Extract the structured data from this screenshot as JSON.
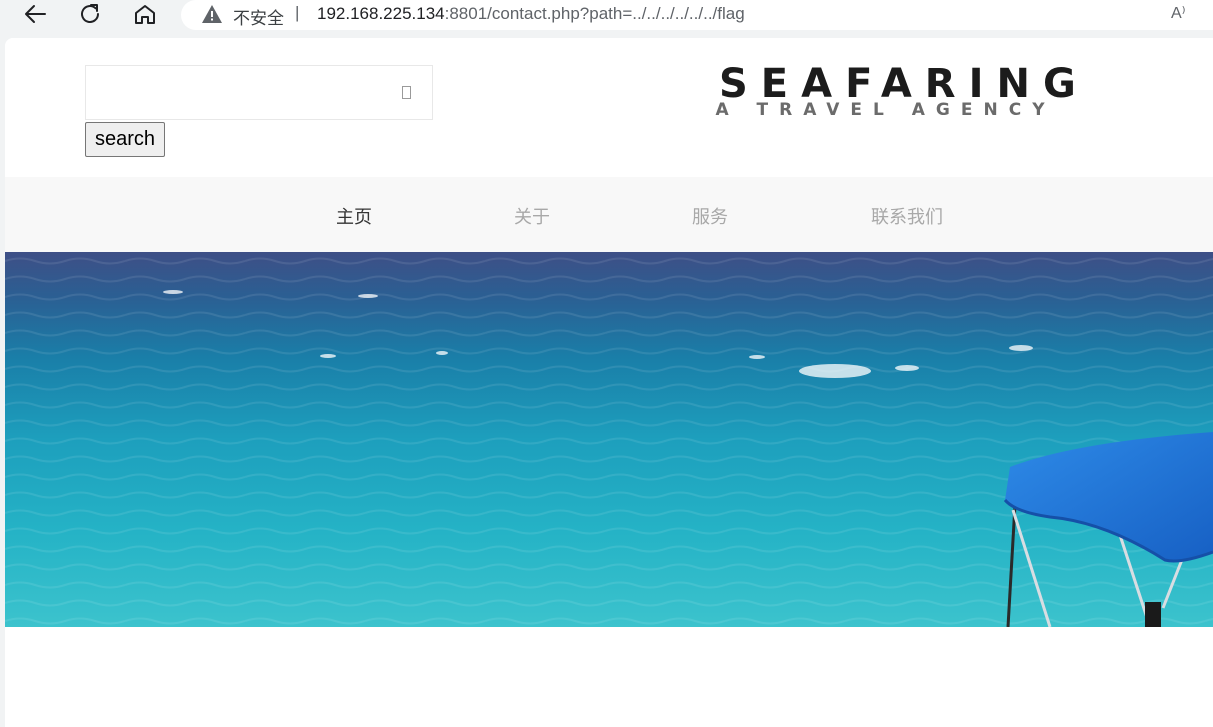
{
  "browser": {
    "security_label": "不安全",
    "separator": "|",
    "url_host": "192.168.225.134",
    "url_rest": ":8801/contact.php?path=../../../../../../flag",
    "icons": [
      "back-arrow-icon",
      "refresh-icon",
      "home-icon",
      "warning-icon",
      "read-aloud-icon"
    ],
    "read_aloud_glyph": "A⁾"
  },
  "header": {
    "search": {
      "value": "",
      "placeholder": "",
      "button_label": "search",
      "icon": "search-icon"
    },
    "logo": {
      "title": "SEAFARING",
      "tagline": "A TRAVEL AGENCY"
    }
  },
  "nav": {
    "items": [
      {
        "label": "主页",
        "active": true
      },
      {
        "label": "关于",
        "active": false
      },
      {
        "label": "服务",
        "active": false
      },
      {
        "label": "联系我们",
        "active": false
      }
    ]
  },
  "hero": {
    "description": "",
    "colors": {
      "sea_dark": "#3f5a8a",
      "sea_mid": "#1f8fb0",
      "sea_light": "#2fbcc9",
      "canopy": "#1e77d6"
    }
  }
}
